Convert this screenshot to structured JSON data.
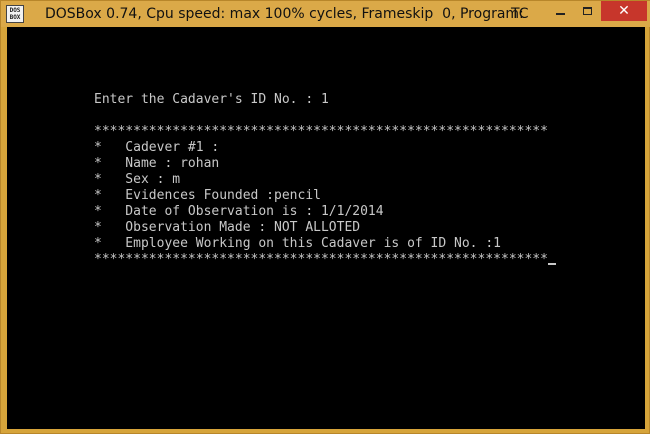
{
  "window": {
    "title": "DOSBox 0.74, Cpu speed: max 100% cycles, Frameskip  0, Program:",
    "program": "TC",
    "icon_text_top": "DOS",
    "icon_text_bottom": "BOX",
    "controls": {
      "minimize_icon": "minimize-icon",
      "maximize_icon": "maximize-icon",
      "close_icon": "close-icon",
      "close_glyph": "✕"
    }
  },
  "terminal": {
    "prompt": "Enter the Cadaver's ID No. : 1",
    "border_top": "**********************************************************",
    "lines": [
      "*   Cadever #1 :",
      "*   Name : rohan",
      "*   Sex : m",
      "*   Evidences Founded :pencil",
      "*   Date of Observation is : 1/1/2014",
      "*   Observation Made : NOT ALLOTED",
      "*   Employee Working on this Cadaver is of ID No. :1"
    ],
    "border_bottom": "**********************************************************"
  },
  "colors": {
    "titlebar": "#dba948",
    "screen": "#000000",
    "text": "#c8c8c8",
    "close": "#c7362b"
  }
}
